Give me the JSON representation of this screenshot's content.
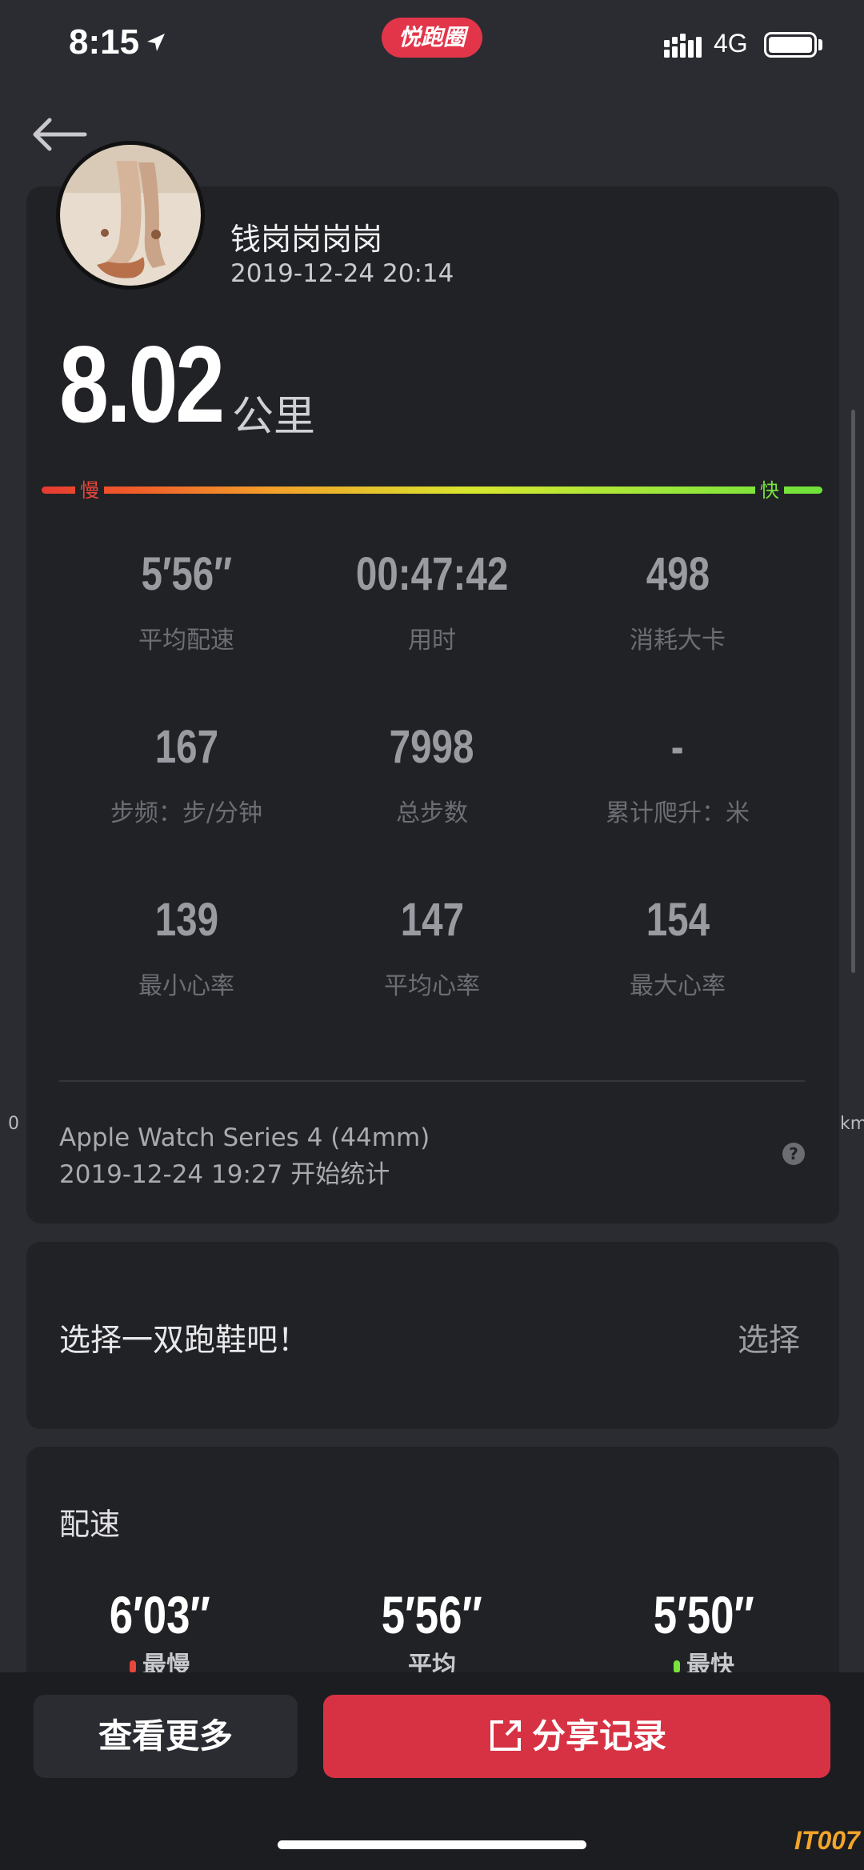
{
  "status_bar": {
    "time": "8:15",
    "app_badge": "悦跑圈",
    "network": "4G"
  },
  "profile": {
    "name": "钱岗岗岗岗",
    "date": "2019-12-24 20:14"
  },
  "distance": {
    "value": "8.02",
    "unit": "公里"
  },
  "speed_bar": {
    "slow_label": "慢",
    "fast_label": "快",
    "colors": [
      "#e53a32",
      "#f2a12a",
      "#d8e62e",
      "#6ee23a"
    ]
  },
  "stats": [
    {
      "value": "5′56′′",
      "label": "平均配速"
    },
    {
      "value": "00:47:42",
      "label": "用时"
    },
    {
      "value": "498",
      "label": "消耗大卡"
    },
    {
      "value": "167",
      "label": "步频：步/分钟"
    },
    {
      "value": "7998",
      "label": "总步数"
    },
    {
      "value": "-",
      "label": "累计爬升：米"
    },
    {
      "value": "139",
      "label": "最小心率"
    },
    {
      "value": "147",
      "label": "平均心率"
    },
    {
      "value": "154",
      "label": "最大心率"
    }
  ],
  "device": {
    "name": "Apple Watch Series 4 (44mm)",
    "start": "2019-12-24 19:27 开始统计",
    "help": "?"
  },
  "edge_labels": {
    "left": "0",
    "right": "km"
  },
  "shoe": {
    "prompt": "选择一双跑鞋吧！",
    "select": "选择"
  },
  "pace": {
    "title": "配速",
    "slowest": {
      "value": "6′03″",
      "label": "最慢",
      "color": "#e8473a"
    },
    "average": {
      "value": "5′56″",
      "label": "平均"
    },
    "fastest": {
      "value": "5′50″",
      "label": "最快",
      "color": "#78e23e"
    }
  },
  "actions": {
    "more": "查看更多",
    "share": "分享记录"
  },
  "watermark": "IT007"
}
